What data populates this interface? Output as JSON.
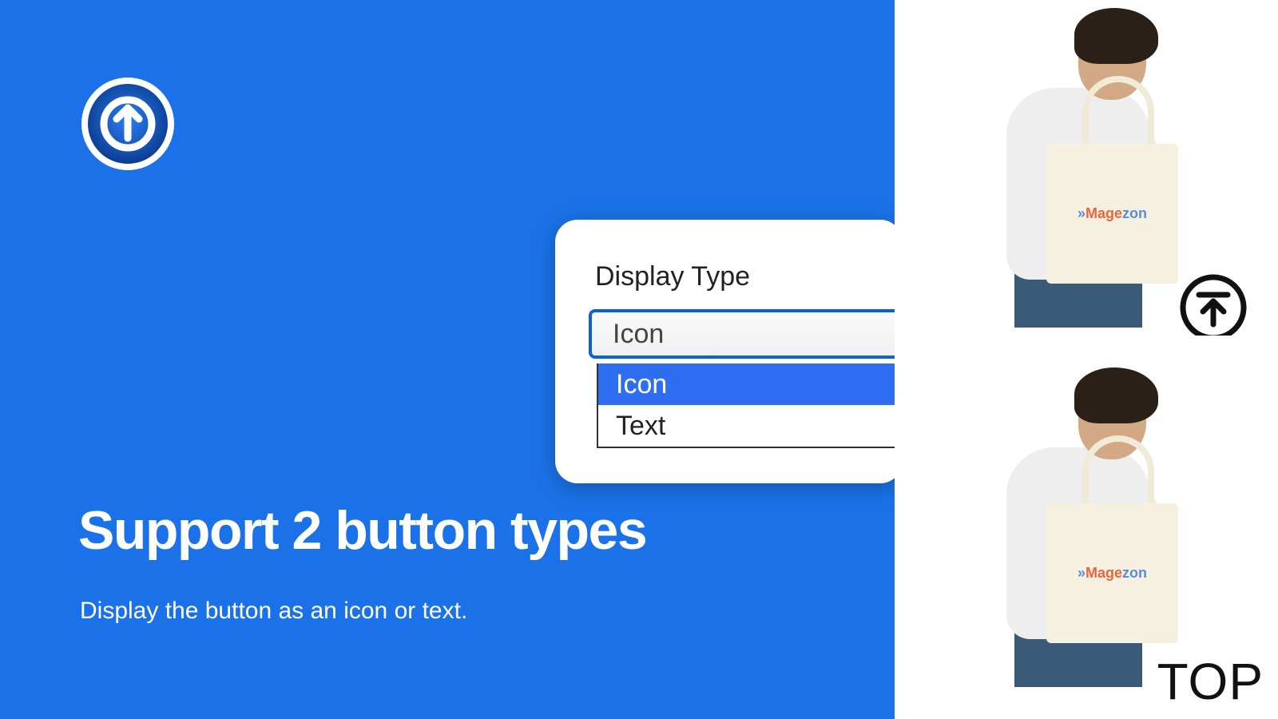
{
  "headline": "Support 2 button types",
  "subhead": "Display the button as an icon or text.",
  "dropdown": {
    "label": "Display Type",
    "selected": "Icon",
    "options": [
      "Icon",
      "Text"
    ]
  },
  "product": {
    "bag_brand_a": "Mage",
    "bag_brand_b": "zon"
  },
  "scroll_text_label": "TOP"
}
